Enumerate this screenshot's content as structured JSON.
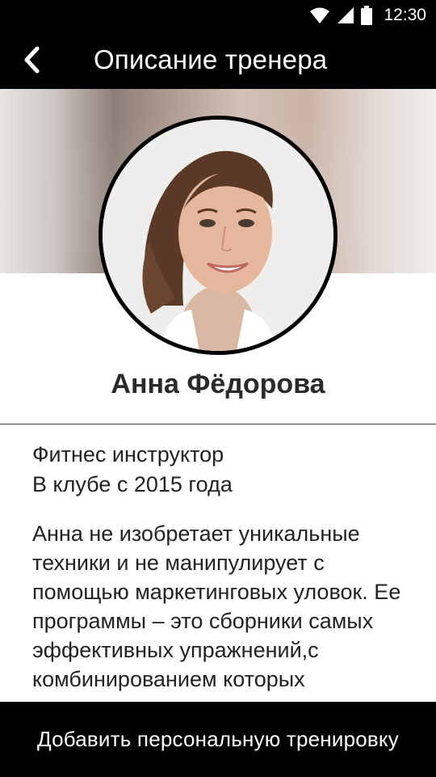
{
  "status_bar": {
    "time": "12:30",
    "icons": [
      "wifi-icon",
      "signal-icon",
      "battery-icon"
    ]
  },
  "app_bar": {
    "back_icon": "chevron-left-icon",
    "title": "Описание тренера"
  },
  "profile": {
    "name": "Анна Фёдорова",
    "role": "Фитнес инструктор",
    "since": "В клубе с 2015 года",
    "description": "Анна не изобретает уникальные техники и не манипулирует с помощью маркетинговых уловок. Ее программы – это сборники самых эффективных упражнений,с комбинированием которых"
  },
  "actions": {
    "add_training": "Добавить персональную тренировку"
  },
  "colors": {
    "bar_background": "#000000",
    "text": "#222222"
  }
}
